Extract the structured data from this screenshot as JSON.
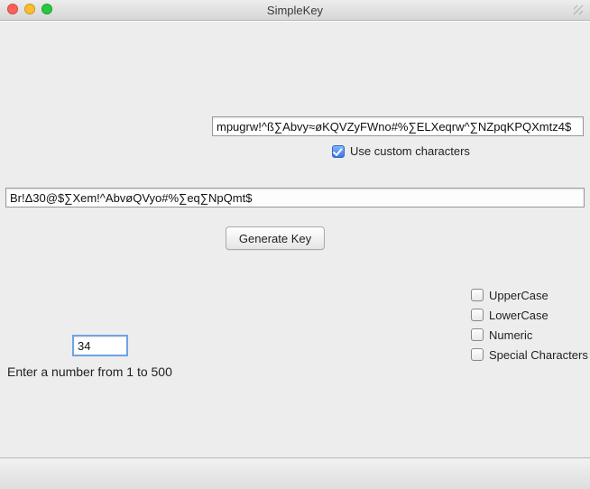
{
  "window": {
    "title": "SimpleKey"
  },
  "custom_chars": {
    "value": "mpugrw!^ß∑Abvy≈øKQVZyFWno#%∑ELXeqrw^∑NZpqKPQXmtz4$",
    "use_custom_label": "Use custom characters",
    "use_custom_checked": true
  },
  "output": {
    "value": "Br!Δ30@$∑Xem!^AbvøQVyo#%∑eq∑NpQmt$"
  },
  "generate": {
    "label": "Generate Key"
  },
  "options": {
    "uppercase": {
      "label": "UpperCase",
      "checked": false
    },
    "lowercase": {
      "label": "LowerCase",
      "checked": false
    },
    "numeric": {
      "label": "Numeric",
      "checked": false
    },
    "special": {
      "label": "Special Characters",
      "checked": false
    }
  },
  "length": {
    "value": "34",
    "hint": "Enter a number from 1 to 500"
  }
}
